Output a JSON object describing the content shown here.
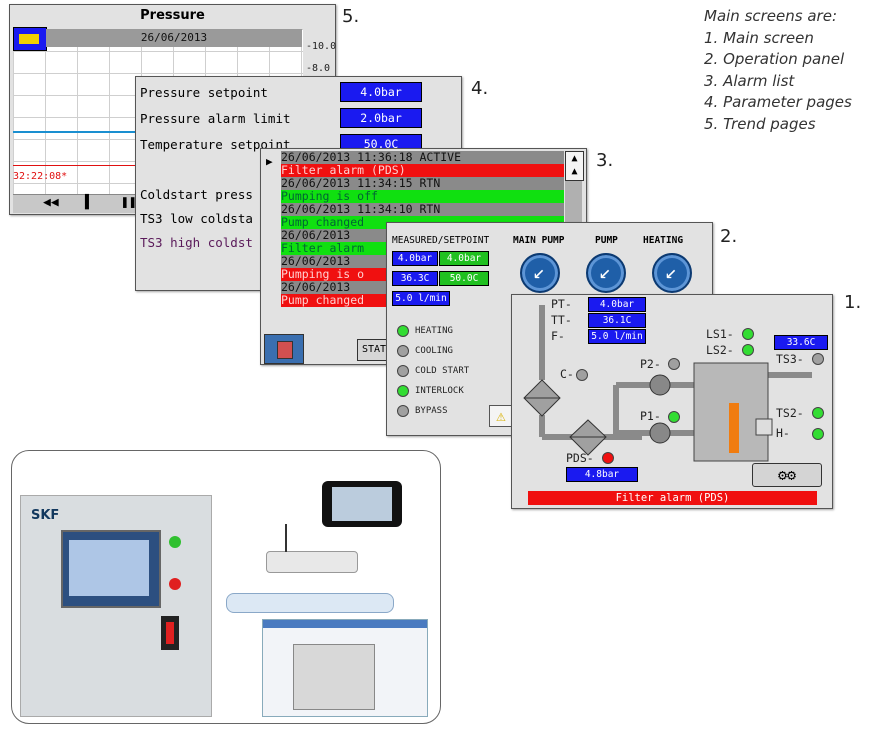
{
  "legend": {
    "heading": "Main screens are:",
    "items": [
      "1. Main screen",
      "2. Operation panel",
      "3. Alarm list",
      "4. Parameter pages",
      "5. Trend pages"
    ]
  },
  "numbers": {
    "n1": "1.",
    "n2": "2.",
    "n3": "3.",
    "n4": "4.",
    "n5": "5."
  },
  "trend": {
    "title": "Pressure",
    "date": "26/06/2013",
    "y_top": "-10.0",
    "y_mid": "-8.0",
    "time": "32:22:08*",
    "controls": [
      "◀◀",
      "▌",
      "❚❚"
    ]
  },
  "params": {
    "rows": [
      {
        "label": "Pressure setpoint",
        "value": "4.0bar"
      },
      {
        "label": "Pressure alarm limit",
        "value": "2.0bar"
      },
      {
        "label": "Temperature setpoint",
        "value": "50.0C"
      },
      {
        "label": "Coldstart press",
        "value": ""
      },
      {
        "label": "TS3 low coldsta",
        "value": ""
      },
      {
        "label": "TS3 high coldst",
        "value": ""
      }
    ]
  },
  "alarms": {
    "rows": [
      {
        "text": "26/06/2013  11:36:18    ACTIVE",
        "style": "d"
      },
      {
        "text": "Filter alarm (PDS)",
        "style": "r"
      },
      {
        "text": "26/06/2013  11:34:15    RTN",
        "style": "d"
      },
      {
        "text": "Pumping is off",
        "style": "g"
      },
      {
        "text": "26/06/2013  11:34:10    RTN",
        "style": "d"
      },
      {
        "text": "Pump changed",
        "style": "g"
      },
      {
        "text": "26/06/2013",
        "style": "d"
      },
      {
        "text": "Filter alarm",
        "style": "g"
      },
      {
        "text": "26/06/2013",
        "style": "d"
      },
      {
        "text": "Pumping is o",
        "style": "r"
      },
      {
        "text": "26/06/2013",
        "style": "d"
      },
      {
        "text": "Pump changed",
        "style": "r"
      }
    ],
    "status_btn": "STAT"
  },
  "operation": {
    "title": "MEASURED/SETPOINT",
    "buttons": [
      "MAIN PUMP",
      "PUMP",
      "HEATING"
    ],
    "values": {
      "p_meas": "4.0bar",
      "p_set": "4.0bar",
      "t_meas": "36.3C",
      "t_set": "50.0C",
      "flow": "5.0 l/min"
    },
    "states": [
      {
        "label": "HEATING",
        "color": "g"
      },
      {
        "label": "COOLING",
        "color": "gr"
      },
      {
        "label": "COLD START",
        "color": "gr"
      },
      {
        "label": "INTERLOCK",
        "color": "g"
      },
      {
        "label": "BYPASS",
        "color": "gr"
      }
    ]
  },
  "main": {
    "pt_label": "PT-",
    "pt_value": "4.0bar",
    "tt_label": "TT-",
    "tt_value": "36.1C",
    "f_label": "F-",
    "f_value": "5.0 l/min",
    "c_label": "C-",
    "p2_label": "P2-",
    "p1_label": "P1-",
    "ls1_label": "LS1-",
    "ls2_label": "LS2-",
    "ts3_label": "TS3-",
    "ts3_value": "33.6C",
    "ts2_label": "TS2-",
    "h_label": "H-",
    "pds_label": "PDS-",
    "pds_value": "4.8bar",
    "alarm": "Filter alarm (PDS)"
  },
  "photo": {
    "brand": "SKF"
  }
}
